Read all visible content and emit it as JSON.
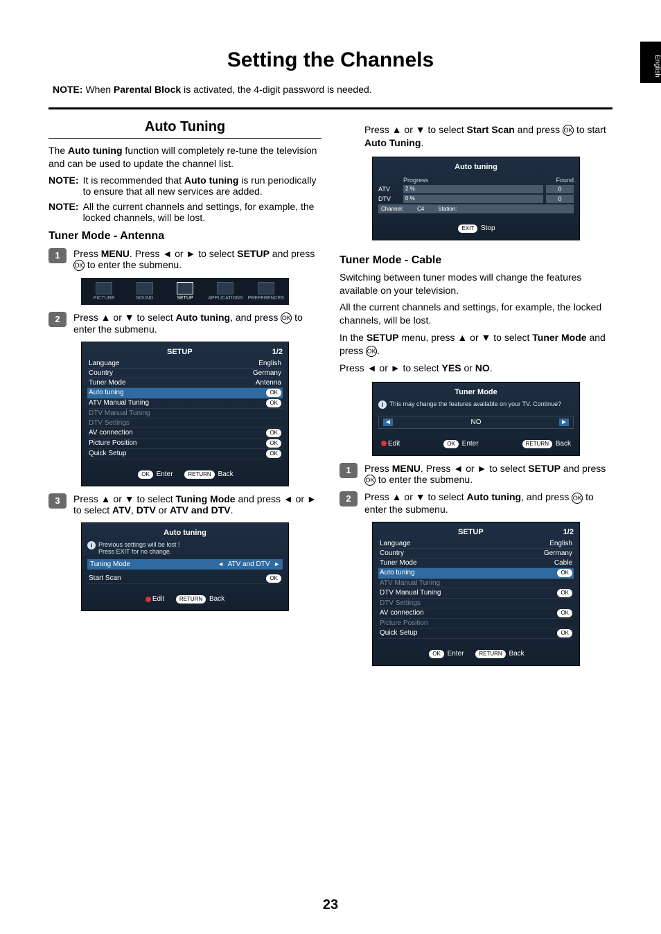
{
  "side_tab": "English",
  "title": "Setting the Channels",
  "top_note_label": "NOTE:",
  "top_note_text_prefix": "When ",
  "top_note_bold": "Parental Block",
  "top_note_text_suffix": " is activated, the 4-digit password is needed.",
  "section_auto_tuning": "Auto Tuning",
  "auto_tuning_intro_pre": "The ",
  "auto_tuning_intro_bold": "Auto tuning",
  "auto_tuning_intro_post": " function will completely re-tune the television and can be used to update the channel list.",
  "note1_label": "NOTE:",
  "note1_text_pre": "It is recommended that ",
  "note1_bold": "Auto tuning",
  "note1_text_post": " is run periodically to ensure that all new services are added.",
  "note2_label": "NOTE:",
  "note2_text": "All the current channels and settings, for example, the locked channels, will be lost.",
  "subhead_antenna": "Tuner Mode - Antenna",
  "step1_antenna_a": "Press ",
  "step1_antenna_menu": "MENU",
  "step1_antenna_b": ". Press ◄ or ► to select ",
  "step1_antenna_setup": "SETUP",
  "step1_antenna_c": " and press ",
  "step1_antenna_d": " to enter  the submenu.",
  "step2_antenna_a": "Press ▲ or ▼ to select ",
  "step2_antenna_bold": "Auto tuning",
  "step2_antenna_b": ", and press ",
  "step2_antenna_c": " to enter the submenu.",
  "step3_a": "Press ▲ or ▼ to select ",
  "step3_bold1": "Tuning Mode",
  "step3_b": " and press ◄ or ► to select ",
  "step3_bold2": "ATV",
  "step3_c": ", ",
  "step3_bold3": "DTV",
  "step3_d": " or ",
  "step3_bold4": "ATV and DTV",
  "step3_e": ".",
  "right_intro_a": "Press ▲ or ▼ to select ",
  "right_intro_bold": "Start Scan",
  "right_intro_b": " and press ",
  "right_intro_c": " to start ",
  "right_intro_bold2": "Auto Tuning",
  "right_intro_d": ".",
  "subhead_cable": "Tuner Mode - Cable",
  "cable_p1": "Switching between tuner modes will change the features available on your television.",
  "cable_p2": "All the current channels and settings, for example, the locked channels, will be lost.",
  "cable_p3_a": "In the ",
  "cable_p3_setup": "SETUP",
  "cable_p3_b": " menu, press ▲ or ▼ to select ",
  "cable_p3_bold": "Tuner Mode",
  "cable_p3_c": " and press ",
  "cable_p3_d": ".",
  "cable_p4_a": "Press ◄ or ► to select ",
  "cable_p4_yes": "YES",
  "cable_p4_b": " or ",
  "cable_p4_no": "NO",
  "cable_p4_c": ".",
  "step1_cable_a": "Press ",
  "step1_cable_menu": "MENU",
  "step1_cable_b": ". Press ◄ or ► to select ",
  "step1_cable_setup": "SETUP",
  "step1_cable_c": " and press ",
  "step1_cable_d": " to enter  the submenu.",
  "step2_cable_a": "Press ▲ or ▼ to select ",
  "step2_cable_bold": "Auto tuning",
  "step2_cable_b": ", and press ",
  "step2_cable_c": " to enter the submenu.",
  "iconbar": {
    "picture": "PICTURE",
    "sound": "SOUND",
    "setup": "SETUP",
    "applications": "APPLICATIONS",
    "preferences": "PREFERENCES"
  },
  "osd_setup": {
    "title": "SETUP",
    "page": "1/2",
    "rows": {
      "language_l": "Language",
      "language_v": "English",
      "country_l": "Country",
      "country_v": "Germany",
      "tuner_l": "Tuner Mode",
      "tuner_v_ant": "Antenna",
      "tuner_v_cab": "Cable",
      "auto_l": "Auto tuning",
      "atvman_l": "ATV Manual Tuning",
      "dtvman_l": "DTV Manual Tuning",
      "dtvset_l": "DTV Settings",
      "avcon_l": "AV connection",
      "picpos_l": "Picture Position",
      "quick_l": "Quick Setup"
    },
    "ok": "OK",
    "footer_enter": "Enter",
    "footer_return": "RETURN",
    "footer_back": "Back"
  },
  "osd_tuning_sub": {
    "title": "Auto tuning",
    "warn1": "Previous settings will be lost !",
    "warn2": "Press EXIT for no change.",
    "tuning_mode_l": "Tuning Mode",
    "tuning_mode_v": "ATV and DTV",
    "start_scan_l": "Start Scan",
    "ok": "OK",
    "edit": "Edit",
    "return": "RETURN",
    "back": "Back"
  },
  "osd_progress": {
    "title": "Auto tuning",
    "progress": "Progress",
    "found": "Found",
    "atv": "ATV",
    "atv_pct": "2  %",
    "atv_found": "0",
    "dtv": "DTV",
    "dtv_pct": "0  %",
    "dtv_found": "0",
    "channel_l": "Channel:",
    "channel_v": "C4",
    "station_l": "Station:",
    "exit": "EXIT",
    "stop": "Stop"
  },
  "osd_tunermode": {
    "title": "Tuner Mode",
    "warn": "This may change the features available on your TV. Continue?",
    "no": "NO",
    "edit": "Edit",
    "ok": "OK",
    "enter": "Enter",
    "return": "RETURN",
    "back": "Back"
  },
  "ok_glyph": "OK",
  "page_number": "23"
}
